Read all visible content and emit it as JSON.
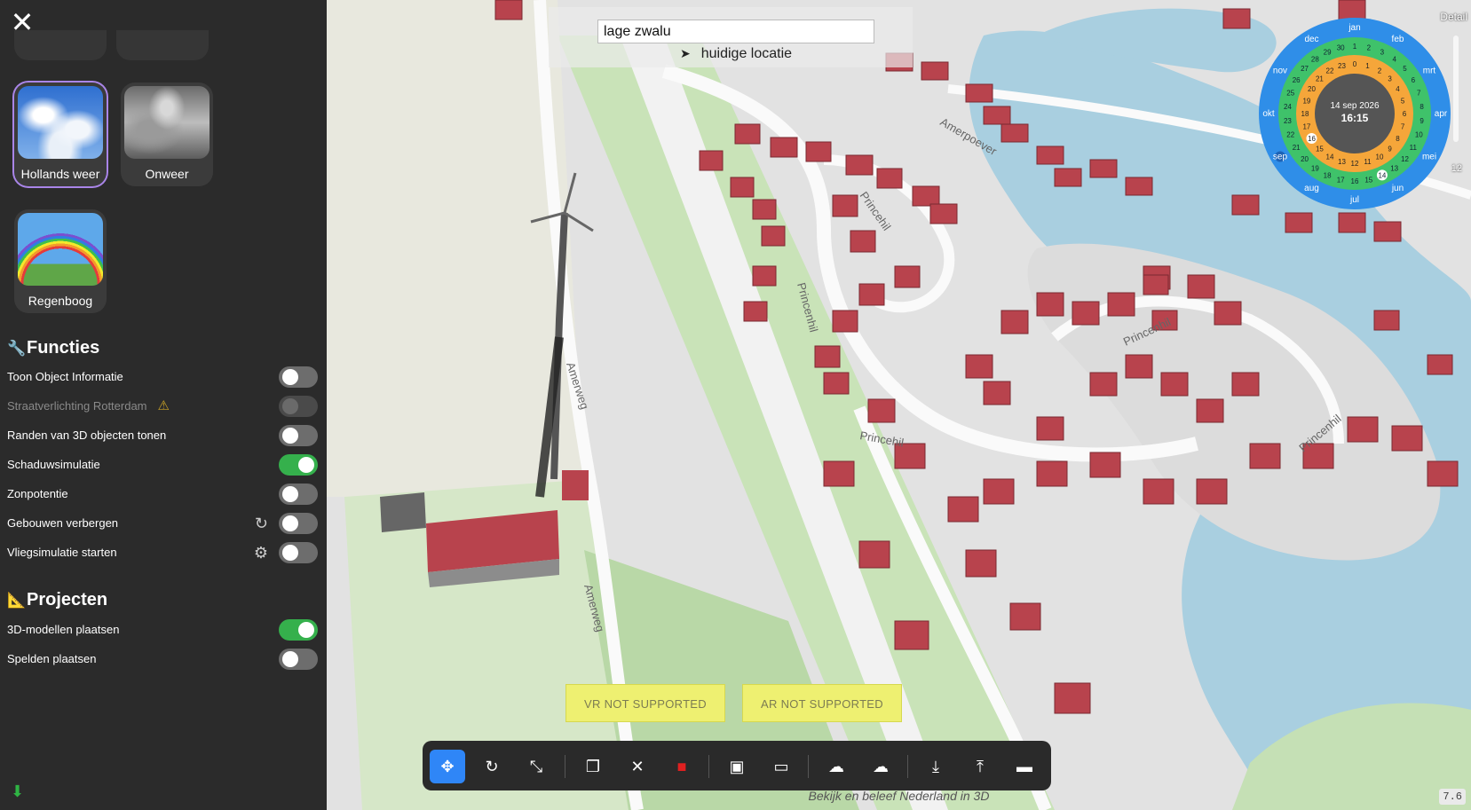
{
  "sidebar": {
    "weather_tiles": [
      {
        "label": "Hollands weer",
        "icon": "clear-sky-clouds"
      },
      {
        "label": "Onweer",
        "icon": "thunderstorm-clouds"
      },
      {
        "label": "Regenboog",
        "icon": "rainbow"
      }
    ],
    "functies": {
      "title": "Functies",
      "icon": "wrench-icon",
      "items": [
        {
          "label": "Toon Object Informatie",
          "on": false
        },
        {
          "label": "Straatverlichting Rotterdam",
          "on": false,
          "disabled": true,
          "icon": "warning-icon"
        },
        {
          "label": "Randen van 3D objecten tonen",
          "on": false
        },
        {
          "label": "Schaduwsimulatie",
          "on": true
        },
        {
          "label": "Zonpotentie",
          "on": false
        },
        {
          "label": "Gebouwen verbergen",
          "on": false,
          "icon": "reset-icon"
        },
        {
          "label": "Vliegsimulatie starten",
          "on": false,
          "icon": "gear-icon"
        }
      ]
    },
    "projecten": {
      "title": "Projecten",
      "icon": "ruler-triangle-icon",
      "items": [
        {
          "label": "3D-modellen plaatsen",
          "on": true
        },
        {
          "label": "Spelden plaatsen",
          "on": false
        }
      ]
    }
  },
  "search": {
    "value": "lage zwalu",
    "suggestion": "huidige locatie"
  },
  "map_labels": {
    "streets": [
      "Amerweg",
      "Amerweg",
      "Princenhil",
      "Princehil",
      "Princenhil",
      "Princehil",
      "Princenhil",
      "Amerpoever"
    ]
  },
  "calendar": {
    "date": "14 sep 2026",
    "time": "16:15",
    "months": [
      "jan",
      "feb",
      "mrt",
      "apr",
      "mei",
      "jun",
      "jul",
      "aug",
      "sep",
      "okt",
      "nov",
      "dec"
    ],
    "selected_month": "sep",
    "days": [
      "1",
      "2",
      "3",
      "4",
      "5",
      "6",
      "7",
      "8",
      "9",
      "10",
      "11",
      "12",
      "13",
      "14",
      "15",
      "16",
      "17",
      "18",
      "19",
      "20",
      "21",
      "22",
      "23",
      "24",
      "25",
      "26",
      "27",
      "28",
      "29",
      "30"
    ],
    "selected_day": "14",
    "hours": [
      "0",
      "1",
      "2",
      "3",
      "4",
      "5",
      "6",
      "7",
      "8",
      "9",
      "10",
      "11",
      "12",
      "13",
      "14",
      "15",
      "16",
      "17",
      "18",
      "19",
      "20",
      "21",
      "22",
      "23"
    ],
    "selected_hour": "16"
  },
  "detail": {
    "label": "Detail",
    "value": "12"
  },
  "buttons": {
    "vr": "VR NOT SUPPORTED",
    "ar": "AR NOT SUPPORTED"
  },
  "toolbar": [
    "move-icon",
    "rotate-icon",
    "scale-icon",
    "copy-icon",
    "close-icon",
    "trash-icon",
    "save-icon",
    "folder-icon",
    "cloud-upload-icon",
    "cloud-download-icon",
    "download-icon",
    "upload-icon",
    "delete-all-icon"
  ],
  "footer": "Bekijk en beleef Nederland in 3D",
  "version": "7.6",
  "colors": {
    "sidebar": "#2b2b2b",
    "toggle_on": "#35b04c",
    "toolbar_active": "#2f86f7",
    "cal_blue": "#2f8ee8",
    "cal_green": "#3fc26a",
    "cal_orange": "#f5a63a"
  }
}
